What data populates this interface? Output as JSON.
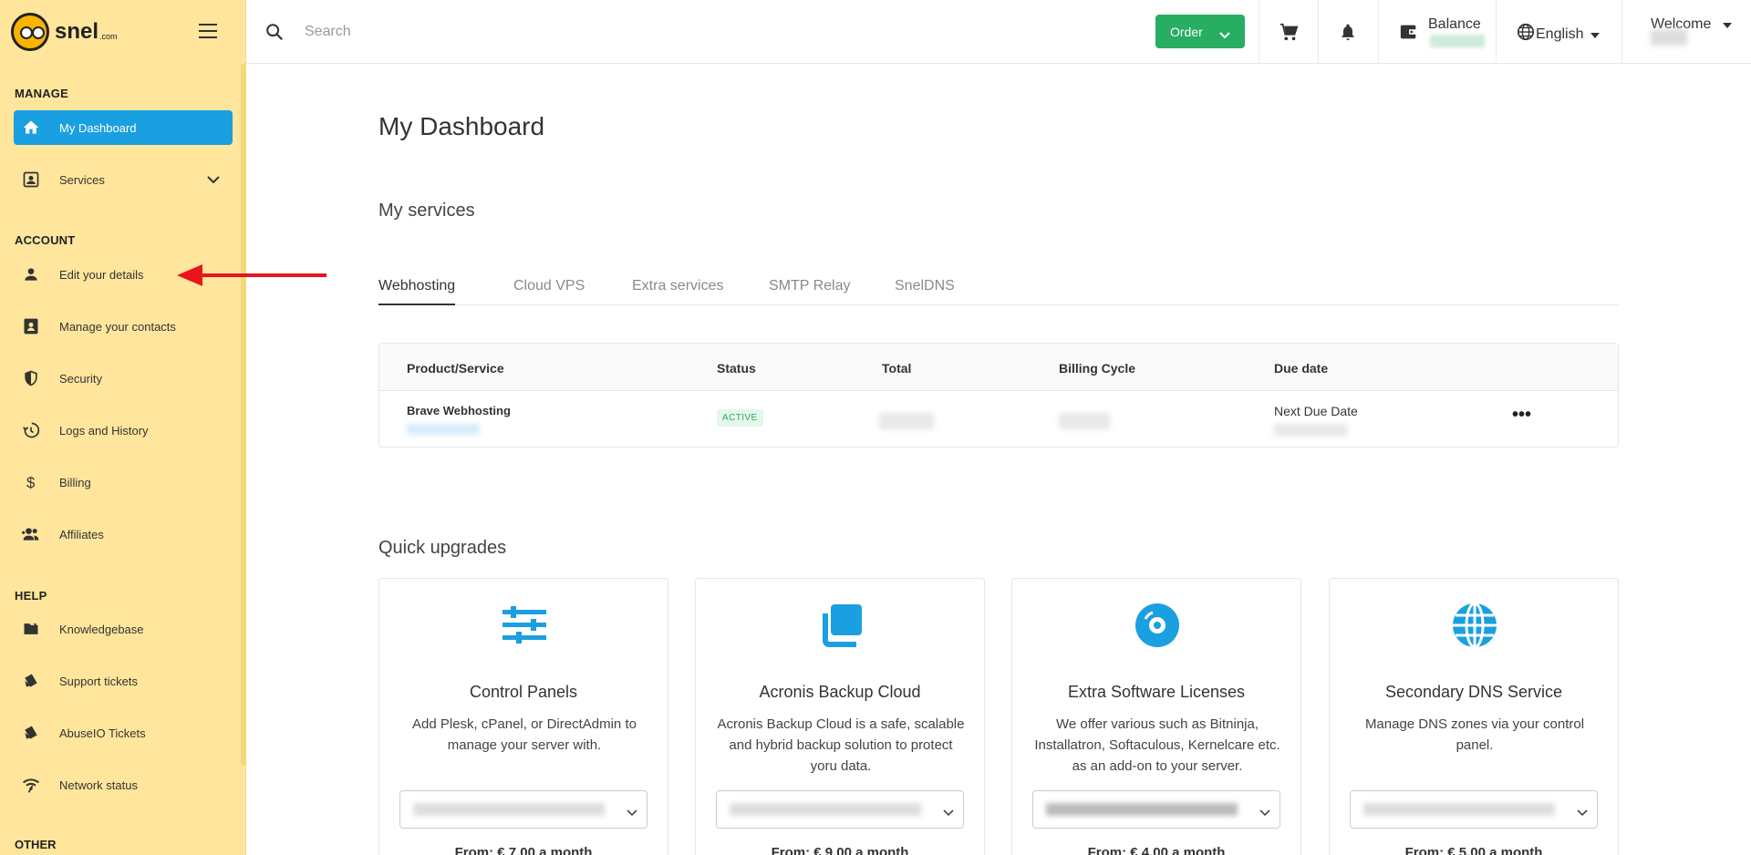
{
  "brand": {
    "name": "snel",
    "tld": ".com"
  },
  "sidebar": {
    "sections": {
      "manage": "MANAGE",
      "account": "ACCOUNT",
      "help": "HELP",
      "other": "OTHER"
    },
    "items": [
      {
        "label": "My Dashboard",
        "icon": "home-icon"
      },
      {
        "label": "Services",
        "icon": "services-icon"
      },
      {
        "label": "Edit your details",
        "icon": "user-icon"
      },
      {
        "label": "Manage your contacts",
        "icon": "contacts-icon"
      },
      {
        "label": "Security",
        "icon": "shield-icon"
      },
      {
        "label": "Logs and History",
        "icon": "history-icon"
      },
      {
        "label": "Billing",
        "icon": "dollar-icon"
      },
      {
        "label": "Affiliates",
        "icon": "affiliates-icon"
      },
      {
        "label": "Knowledgebase",
        "icon": "folder-icon"
      },
      {
        "label": "Support tickets",
        "icon": "ticket-icon"
      },
      {
        "label": "AbuseIO Tickets",
        "icon": "ticket-icon"
      },
      {
        "label": "Network status",
        "icon": "wifi-icon"
      }
    ]
  },
  "topbar": {
    "search_placeholder": "Search",
    "order_label": "Order",
    "balance_label": "Balance",
    "language": "English",
    "welcome": "Welcome"
  },
  "main": {
    "title": "My Dashboard",
    "services_title": "My services",
    "tabs": [
      "Webhosting",
      "Cloud VPS",
      "Extra services",
      "SMTP Relay",
      "SnelDNS"
    ],
    "table": {
      "headers": [
        "Product/Service",
        "Status",
        "Total",
        "Billing Cycle",
        "Due date"
      ],
      "row": {
        "product": "Brave Webhosting",
        "status": "ACTIVE",
        "due_label": "Next Due Date"
      }
    },
    "quick_upgrades_title": "Quick upgrades",
    "cards": [
      {
        "title": "Control Panels",
        "desc": "Add Plesk, cPanel, or DirectAdmin to manage your server with.",
        "price": "From: € 7.00 a month",
        "icon": "sliders-icon"
      },
      {
        "title": "Acronis Backup Cloud",
        "desc": "Acronis Backup Cloud is a safe, scalable and hybrid backup solution to protect yoru data.",
        "price": "From: € 9.00 a month",
        "icon": "copy-icon"
      },
      {
        "title": "Extra Software Licenses",
        "desc": "We offer various such as Bitninja, Installatron, Softaculous, Kernelcare etc. as an add-on to your server.",
        "price": "From: € 4.00 a month",
        "icon": "disc-icon"
      },
      {
        "title": "Secondary DNS Service",
        "desc": "Manage DNS zones via your control panel.",
        "price": "From: € 5.00 a month",
        "icon": "globe-icon"
      }
    ]
  },
  "colors": {
    "sidebar_bg": "#ffe69c",
    "active": "#1aa0e0",
    "order": "#27ae60",
    "accent_icon": "#1aa0e0",
    "arrow": "#e8141e"
  }
}
